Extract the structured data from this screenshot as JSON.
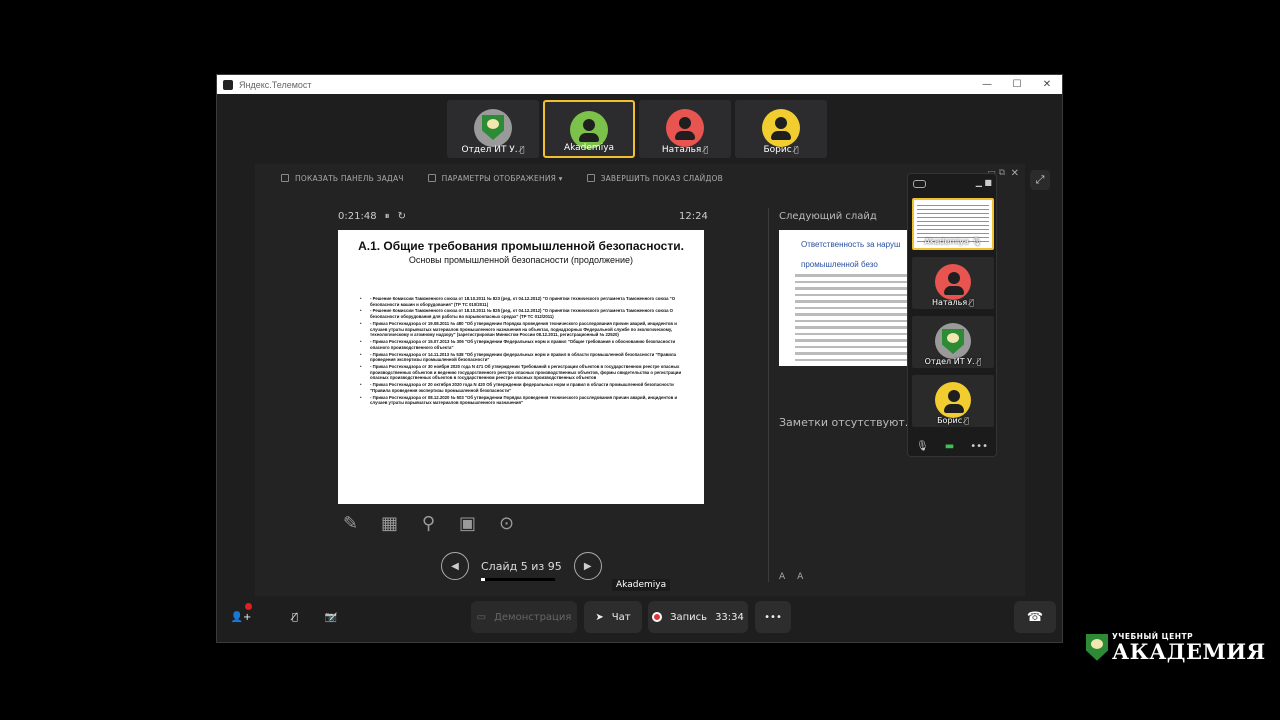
{
  "window": {
    "title": "Яндекс.Телемост",
    "controls": [
      "—",
      "☐",
      "✕"
    ]
  },
  "participants": [
    {
      "name": "Отдел ИТ У.",
      "color": "#9a9a9a",
      "avatar": "shield-logo",
      "muted": true,
      "active": false
    },
    {
      "name": "Akademiya",
      "color": "#7bc14a",
      "avatar": "person",
      "muted": false,
      "active": true
    },
    {
      "name": "Наталья",
      "color": "#e8544f",
      "avatar": "person",
      "muted": true,
      "active": false
    },
    {
      "name": "Борис",
      "color": "#f2cd30",
      "avatar": "person",
      "muted": true,
      "active": false
    }
  ],
  "presenter": {
    "show_taskbar": "ПОКАЗАТЬ ПАНЕЛЬ ЗАДАЧ",
    "display_settings": "ПАРАМЕТРЫ ОТОБРАЖЕНИЯ ▾",
    "end_show": "ЗАВЕРШИТЬ ПОКАЗ СЛАЙДОВ",
    "elapsed": "0:21:48",
    "pause_icon": "⏸",
    "reset_icon": "↻",
    "clock": "12:24",
    "slide_counter": "Слайд 5 из 95",
    "next_label": "Следующий слайд",
    "notes": "Заметки отсутствуют.",
    "font_larger": "A",
    "font_smaller": "A"
  },
  "slide": {
    "title": "А.1. Общие требования промышленной безопасности.",
    "subtitle": "Основы промышленной безопасности (продолжение)",
    "items": [
      "- Решение Комиссии Таможенного союза от 18.10.2011 № 823 (ред. от 04.12.2012) \"О принятии технического регламента Таможенного союза \"О безопасности машин и оборудования\" (ТР ТС 010/2011)",
      "- Решение Комиссии Таможенного союза от 18.10.2011 № 825 (ред. от 04.12.2012) \"О принятии технического регламента Таможенного союза О безопасности оборудования для работы во взрывоопасных средах\" (ТР ТС 012/2011)",
      "- Приказ Ростехнадзора от 19.08.2011 № 480 \"Об утверждении Порядка проведения технического расследования причин аварий, инцидентов и случаев утраты взрывчатых материалов промышленного назначения на объектах, поднадзорных Федеральной службе по экологическому, технологическому и атомному надзору\" (зарегистрирован Минюстом России 08.12.2011, регистрационный № 22520)",
      "- Приказ Ростехнадзора от 15.07.2013 № 306 \"Об утверждении Федеральных норм и правил \"Общие требования к обоснованию безопасности опасного производственного объекта\"",
      "- Приказ Ростехнадзора от 14.11.2013 № 538 \"Об утверждении федеральных норм и правил в области промышленной безопасности \"Правила проведения экспертизы промышленной безопасности\"",
      "- Приказ Ростехнадзора от 30 ноября 2020 года N 471 Об утверждении Требований к регистрации объектов в государственном реестре опасных производственных объектов и ведению государственного реестра опасных производственных объектов, формы свидетельства о регистрации опасных производственных объектов в государственном реестре опасных производственных объектов",
      "- Приказ Ростехнадзора от 20 октября 2020 года N 420 Об утверждении федеральных норм и правил в области промышленной безопасности \"Правила проведения экспертизы промышленной безопасности\"",
      "- Приказ Ростехнадзора от 08.12.2020 № 503 \"Об утверждении Порядка проведения технического расследования причин аварий, инцидентов и случаев утраты взрывчатых материалов промышленного назначения\""
    ]
  },
  "next_slide": {
    "title_line1": "Ответственность за наруш",
    "title_line2": "промышленной безо"
  },
  "mini_panel": {
    "tiles": [
      {
        "name": "Akademiya",
        "kind": "screen",
        "mic": "on"
      },
      {
        "name": "Наталья",
        "kind": "person",
        "color": "#e8544f",
        "mic": "off"
      },
      {
        "name": "Отдел ИТ У.",
        "kind": "shield",
        "color": "#9a9a9a",
        "mic": "off"
      },
      {
        "name": "Борис",
        "kind": "person",
        "color": "#f2cd30",
        "mic": "off"
      }
    ]
  },
  "tooltip": "Akademiya",
  "bottom_bar": {
    "demo_label": "Демонстрация",
    "chat_label": "Чат",
    "record_label": "Запись",
    "record_time": "33:34",
    "more_label": "•••"
  },
  "logo": {
    "small": "УЧЕБНЫЙ ЦЕНТР",
    "big": "АКАДЕМИЯ",
    "color": "#2e8b35"
  }
}
